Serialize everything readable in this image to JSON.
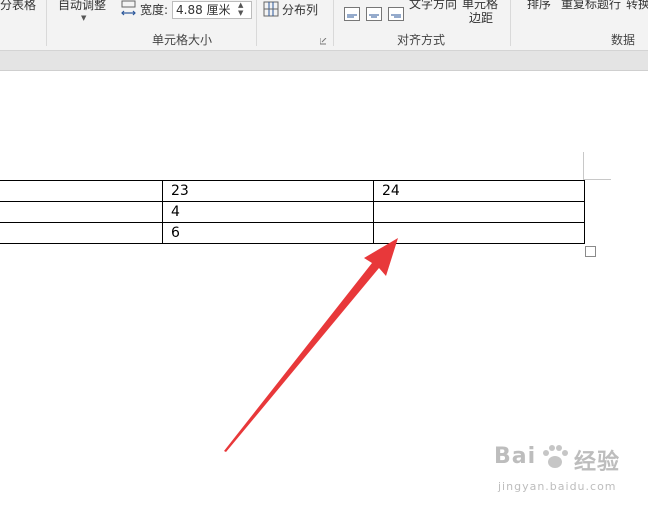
{
  "ribbon": {
    "split_table": "分表格",
    "autofit": "自动调整",
    "width_label": "宽度:",
    "width_value": "4.88 厘米",
    "distribute_columns": "分布列",
    "cell_size_group": "单元格大小",
    "text_direction": "文字方向",
    "cell_margins_line1": "单元格",
    "cell_margins_line2": "边距",
    "alignment_group": "对齐方式",
    "sort": "排序",
    "repeat_header_rows": "重复标题行",
    "convert": "转换",
    "data_group": "数据"
  },
  "table": {
    "rows": [
      [
        "",
        "23",
        "24"
      ],
      [
        "",
        "4",
        ""
      ],
      [
        "",
        "6",
        ""
      ]
    ]
  },
  "watermark": {
    "brand": "Bai",
    "brand_cn": "经验",
    "url": "jingyan.baidu.com"
  },
  "colors": {
    "arrow": "#e8383a",
    "ribbon_bg": "#f3f3f3",
    "accent_icon": "#2b579a"
  }
}
